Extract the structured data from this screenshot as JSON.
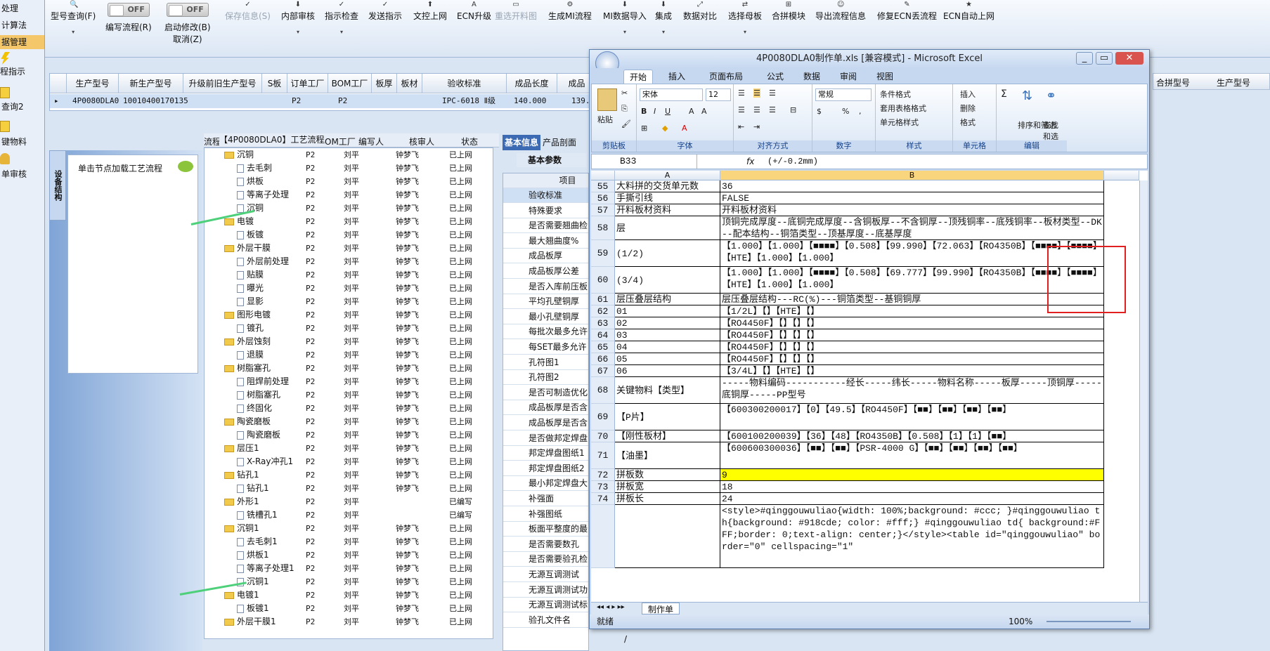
{
  "left_nav": {
    "items": [
      "处理",
      "计算法",
      "据管理"
    ],
    "icon_items": [
      "程指示",
      "查询2",
      "键物料",
      "单审核"
    ]
  },
  "toolbar": {
    "buttons": [
      "型号查询(F)",
      "编写流程(R)",
      "启动修改(B)",
      "保存信息(S)",
      "内部审核",
      "指示检查",
      "发送指示",
      "文控上网",
      "ECN升级",
      "重选开料图",
      "生成MI流程",
      "MI数据导入",
      "集成",
      "数据对比",
      "选择母板",
      "合拼模块",
      "导出流程信息",
      "修复ECN丢流程",
      "ECN自动上网"
    ],
    "cancel_label": "取消(Z)",
    "toggle_off": "OFF"
  },
  "top_grid": {
    "headers": [
      "生产型号",
      "新生产型号",
      "升级前旧生产型号",
      "S板",
      "订单工厂",
      "BOM工厂",
      "板厚",
      "板材",
      "验收标准",
      "成品长度",
      "成品"
    ],
    "row": [
      "4P0080DLA0",
      "10010400170135",
      "",
      "",
      "P2",
      "P2",
      "",
      "",
      "IPC-6018 Ⅱ级",
      "140.000",
      "139."
    ],
    "right_headers": [
      "合拼型号",
      "生产型号"
    ]
  },
  "side_panel": {
    "tab_label": "设备结构",
    "hint": "单击节点加载工艺流程"
  },
  "tree": {
    "title": "【4P0080DLA0】工艺流程",
    "headers": [
      "流程",
      "BOM工厂",
      "编写人",
      "核审人",
      "状态"
    ],
    "rows": [
      {
        "name": "沉铜",
        "folder": true,
        "level": 1,
        "bom": "P2",
        "writer": "刘平",
        "reviewer": "钟梦飞",
        "status": "已上网"
      },
      {
        "name": "去毛刺",
        "folder": false,
        "level": 2,
        "bom": "P2",
        "writer": "刘平",
        "reviewer": "钟梦飞",
        "status": "已上网"
      },
      {
        "name": "烘板",
        "folder": false,
        "level": 2,
        "bom": "P2",
        "writer": "刘平",
        "reviewer": "钟梦飞",
        "status": "已上网"
      },
      {
        "name": "等离子处理",
        "folder": false,
        "level": 2,
        "bom": "P2",
        "writer": "刘平",
        "reviewer": "钟梦飞",
        "status": "已上网"
      },
      {
        "name": "沉铜",
        "folder": false,
        "level": 2,
        "bom": "P2",
        "writer": "刘平",
        "reviewer": "钟梦飞",
        "status": "已上网"
      },
      {
        "name": "电镀",
        "folder": true,
        "level": 1,
        "bom": "P2",
        "writer": "刘平",
        "reviewer": "钟梦飞",
        "status": "已上网"
      },
      {
        "name": "板镀",
        "folder": false,
        "level": 2,
        "bom": "P2",
        "writer": "刘平",
        "reviewer": "钟梦飞",
        "status": "已上网"
      },
      {
        "name": "外层干膜",
        "folder": true,
        "level": 1,
        "bom": "P2",
        "writer": "刘平",
        "reviewer": "钟梦飞",
        "status": "已上网"
      },
      {
        "name": "外层前处理",
        "folder": false,
        "level": 2,
        "bom": "P2",
        "writer": "刘平",
        "reviewer": "钟梦飞",
        "status": "已上网"
      },
      {
        "name": "贴膜",
        "folder": false,
        "level": 2,
        "bom": "P2",
        "writer": "刘平",
        "reviewer": "钟梦飞",
        "status": "已上网"
      },
      {
        "name": "曝光",
        "folder": false,
        "level": 2,
        "bom": "P2",
        "writer": "刘平",
        "reviewer": "钟梦飞",
        "status": "已上网"
      },
      {
        "name": "显影",
        "folder": false,
        "level": 2,
        "bom": "P2",
        "writer": "刘平",
        "reviewer": "钟梦飞",
        "status": "已上网"
      },
      {
        "name": "图形电镀",
        "folder": true,
        "level": 1,
        "bom": "P2",
        "writer": "刘平",
        "reviewer": "钟梦飞",
        "status": "已上网"
      },
      {
        "name": "镀孔",
        "folder": false,
        "level": 2,
        "bom": "P2",
        "writer": "刘平",
        "reviewer": "钟梦飞",
        "status": "已上网"
      },
      {
        "name": "外层蚀刻",
        "folder": true,
        "level": 1,
        "bom": "P2",
        "writer": "刘平",
        "reviewer": "钟梦飞",
        "status": "已上网"
      },
      {
        "name": "退膜",
        "folder": false,
        "level": 2,
        "bom": "P2",
        "writer": "刘平",
        "reviewer": "钟梦飞",
        "status": "已上网"
      },
      {
        "name": "树脂塞孔",
        "folder": true,
        "level": 1,
        "bom": "P2",
        "writer": "刘平",
        "reviewer": "钟梦飞",
        "status": "已上网"
      },
      {
        "name": "阻焊前处理",
        "folder": false,
        "level": 2,
        "bom": "P2",
        "writer": "刘平",
        "reviewer": "钟梦飞",
        "status": "已上网"
      },
      {
        "name": "树脂塞孔",
        "folder": false,
        "level": 2,
        "bom": "P2",
        "writer": "刘平",
        "reviewer": "钟梦飞",
        "status": "已上网"
      },
      {
        "name": "终固化",
        "folder": false,
        "level": 2,
        "bom": "P2",
        "writer": "刘平",
        "reviewer": "钟梦飞",
        "status": "已上网"
      },
      {
        "name": "陶瓷磨板",
        "folder": true,
        "level": 1,
        "bom": "P2",
        "writer": "刘平",
        "reviewer": "钟梦飞",
        "status": "已上网"
      },
      {
        "name": "陶瓷磨板",
        "folder": false,
        "level": 2,
        "bom": "P2",
        "writer": "刘平",
        "reviewer": "钟梦飞",
        "status": "已上网"
      },
      {
        "name": "层压1",
        "folder": true,
        "level": 1,
        "bom": "P2",
        "writer": "刘平",
        "reviewer": "钟梦飞",
        "status": "已上网"
      },
      {
        "name": "X-Ray冲孔1",
        "folder": false,
        "level": 2,
        "bom": "P2",
        "writer": "刘平",
        "reviewer": "钟梦飞",
        "status": "已上网"
      },
      {
        "name": "钻孔1",
        "folder": true,
        "level": 1,
        "bom": "P2",
        "writer": "刘平",
        "reviewer": "钟梦飞",
        "status": "已上网"
      },
      {
        "name": "钻孔1",
        "folder": false,
        "level": 2,
        "bom": "P2",
        "writer": "刘平",
        "reviewer": "钟梦飞",
        "status": "已上网"
      },
      {
        "name": "外形1",
        "folder": true,
        "level": 1,
        "bom": "P2",
        "writer": "刘平",
        "reviewer": "",
        "status": "已编写"
      },
      {
        "name": "铣槽孔1",
        "folder": false,
        "level": 2,
        "bom": "P2",
        "writer": "刘平",
        "reviewer": "",
        "status": "已编写"
      },
      {
        "name": "沉铜1",
        "folder": true,
        "level": 1,
        "bom": "P2",
        "writer": "刘平",
        "reviewer": "钟梦飞",
        "status": "已上网"
      },
      {
        "name": "去毛刺1",
        "folder": false,
        "level": 2,
        "bom": "P2",
        "writer": "刘平",
        "reviewer": "钟梦飞",
        "status": "已上网"
      },
      {
        "name": "烘板1",
        "folder": false,
        "level": 2,
        "bom": "P2",
        "writer": "刘平",
        "reviewer": "钟梦飞",
        "status": "已上网"
      },
      {
        "name": "等离子处理1",
        "folder": false,
        "level": 2,
        "bom": "P2",
        "writer": "刘平",
        "reviewer": "钟梦飞",
        "status": "已上网"
      },
      {
        "name": "沉铜1",
        "folder": false,
        "level": 2,
        "bom": "P2",
        "writer": "刘平",
        "reviewer": "钟梦飞",
        "status": "已上网"
      },
      {
        "name": "电镀1",
        "folder": true,
        "level": 1,
        "bom": "P2",
        "writer": "刘平",
        "reviewer": "钟梦飞",
        "status": "已上网"
      },
      {
        "name": "板镀1",
        "folder": false,
        "level": 2,
        "bom": "P2",
        "writer": "刘平",
        "reviewer": "钟梦飞",
        "status": "已上网"
      },
      {
        "name": "外层干膜1",
        "folder": true,
        "level": 1,
        "bom": "P2",
        "writer": "刘平",
        "reviewer": "钟梦飞",
        "status": "已上网"
      }
    ]
  },
  "info": {
    "tabs": [
      "基本信息",
      "产品剖面"
    ],
    "subtab": "基本参数",
    "col_header": "项目",
    "items": [
      "验收标准",
      "特殊要求",
      "是否需要翘曲检",
      "最大翘曲度%",
      "成品板厚",
      "成品板厚公差",
      "是否入库前压板",
      "平均孔壁铜厚",
      "最小孔壁铜厚",
      "每批次最多允许",
      "每SET最多允许",
      "孔符图1",
      "孔符图2",
      "是否可制造优化",
      "成品板厚是否含",
      "成品板厚是否含",
      "是否做邦定焊盘",
      "邦定焊盘图纸1",
      "邦定焊盘图纸2",
      "最小邦定焊盘大",
      "补强面",
      "补强图纸",
      "板面平整度的最",
      "是否需要数孔",
      "是否需要验孔检",
      "无源互调测试",
      "无源互调测试功",
      "无源互调测试标",
      "验孔文件名"
    ],
    "last_value": "/"
  },
  "excel": {
    "title": "4P0080DLA0制作单.xls [兼容模式] - Microsoft Excel",
    "tabs": [
      "开始",
      "插入",
      "页面布局",
      "公式",
      "数据",
      "审阅",
      "视图"
    ],
    "font_name": "宋体",
    "font_size": "12",
    "number_format": "常规",
    "groups": [
      "剪贴板",
      "字体",
      "对齐方式",
      "数字",
      "样式",
      "单元格",
      "编辑"
    ],
    "paste_label": "粘贴",
    "style_items": [
      "条件格式",
      "套用表格格式",
      "单元格样式"
    ],
    "cell_items": [
      "插入",
      "删除",
      "格式"
    ],
    "edit_items": [
      "排序和筛选",
      "查找和选择"
    ],
    "name_box": "B33",
    "formula": "(+/-0.2mm)",
    "col_a": "A",
    "col_b": "B",
    "rows": [
      {
        "n": "55",
        "a": "大料拼的交货单元数",
        "b": "36",
        "h": 17
      },
      {
        "n": "56",
        "a": "手撕引线",
        "b": "FALSE",
        "h": 17
      },
      {
        "n": "57",
        "a": "开料板材资料",
        "b": "开料板材资料",
        "h": 17
      },
      {
        "n": "58",
        "a": "层",
        "b": "顶铜完成厚度--底铜完成厚度--含铜板厚--不含铜厚--顶残铜率--底残铜率--板材类型--DK--配本结构--铜箔类型--顶基厚度--底基厚度",
        "h": 34
      },
      {
        "n": "59",
        "a": "(1/2)",
        "b": "【1.000】【1.000】【■■■■】【0.508】【99.990】【72.063】【RO4350B】【■■■■】【■■■■】【HTE】【1.000】【1.000】",
        "h": 38
      },
      {
        "n": "60",
        "a": "(3/4)",
        "b": "【1.000】【1.000】【■■■■】【0.508】【69.777】【99.990】【RO4350B】【■■■■】【■■■■】【HTE】【1.000】【1.000】",
        "h": 38
      },
      {
        "n": "61",
        "a": "层压叠层结构",
        "b": "层压叠层结构---RC(%)---铜箔类型--基铜铜厚",
        "h": 17
      },
      {
        "n": "62",
        "a": "01",
        "b": "【1/2L】【】【HTE】【】",
        "h": 17
      },
      {
        "n": "63",
        "a": "02",
        "b": "【RO4450F】【】【】【】",
        "h": 17
      },
      {
        "n": "64",
        "a": "03",
        "b": "【RO4450F】【】【】【】",
        "h": 17
      },
      {
        "n": "65",
        "a": "04",
        "b": "【RO4450F】【】【】【】",
        "h": 17
      },
      {
        "n": "66",
        "a": "05",
        "b": "【RO4450F】【】【】【】",
        "h": 17
      },
      {
        "n": "67",
        "a": "06",
        "b": "【3/4L】【】【HTE】【】",
        "h": 17
      },
      {
        "n": "68",
        "a": "关键物料【类型】",
        "b": "-----物料编码-----------经长-----纬长-----物料名称-----板厚-----顶铜厚-----底铜厚-----PP型号",
        "h": 38
      },
      {
        "n": "69",
        "a": "【P片】",
        "b": "【600300200017】【0】【49.5】【RO4450F】【■■】【■■】【■■】【■■】",
        "h": 38
      },
      {
        "n": "70",
        "a": "【刚性板材】",
        "b": "【600100200039】【36】【48】【RO4350B】【0.508】【1】【1】【■■】",
        "h": 17
      },
      {
        "n": "71",
        "a": "【油墨】",
        "b": "【600600300036】【■■】【■■】【PSR-4000 G】【■■】【■■】【■■】【■■】",
        "h": 38
      },
      {
        "n": "72",
        "a": "拼板数",
        "b": "9",
        "h": 17,
        "yellow": true
      },
      {
        "n": "73",
        "a": "拼板宽",
        "b": "18",
        "h": 17
      },
      {
        "n": "74",
        "a": "拼板长",
        "b": "24",
        "h": 17
      },
      {
        "n": "",
        "a": "",
        "b": "<style>#qinggouwuliao{width: 100%;background: #ccc; }#qinggouwuliao th{background: #918cde; color: #fff;} #qinggouwuliao td{ background:#FFF;border: 0;text-align: center;}</style><table id=\"qinggouwuliao\" border=\"0\" cellspacing=\"1\"",
        "h": 90
      }
    ],
    "sheet_tab": "制作单",
    "status": "就绪",
    "zoom": "100%"
  }
}
